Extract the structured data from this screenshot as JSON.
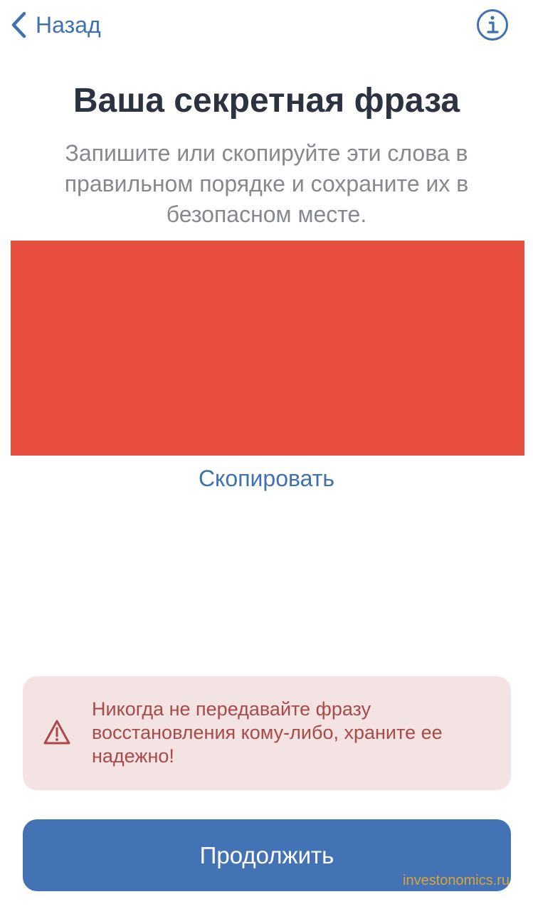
{
  "nav": {
    "back_label": "Назад",
    "back_icon": "chevron-left-icon",
    "info_icon": "info-icon"
  },
  "header": {
    "title": "Ваша секретная фраза",
    "subtitle": "Запишите или скопируйте эти слова в правильном порядке и сохраните их в безопасном месте."
  },
  "phrase": {
    "redaction_color": "#e84e3e"
  },
  "copy": {
    "label": "Скопировать"
  },
  "warning": {
    "icon": "warning-triangle-icon",
    "text": "Никогда не передавайте фразу восстановления кому-либо, храните ее надежно!"
  },
  "primary_action": {
    "label": "Продолжить"
  },
  "watermark": {
    "text": "investonomics.ru"
  },
  "colors": {
    "accent": "#3f70b0",
    "button": "#4473b5",
    "warning_bg": "#f3e3e3",
    "warning_text": "#a84a48"
  }
}
